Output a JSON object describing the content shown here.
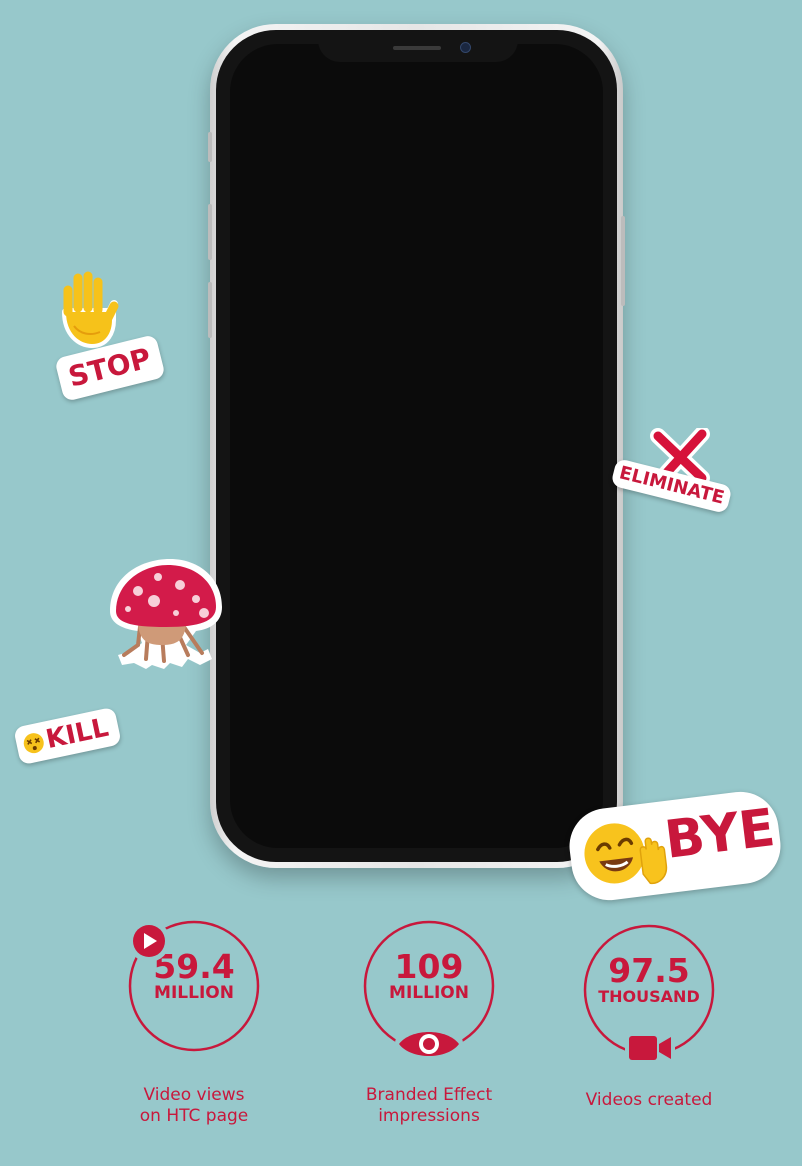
{
  "colors": {
    "background": "#97c8cb",
    "accent": "#c8183c",
    "sticker_bg": "#ffffff"
  },
  "stickers": {
    "stop": {
      "text": "STOP",
      "icon": "raised-hand-icon"
    },
    "eliminate": {
      "text": "ELIMINATE",
      "icon": "red-x-icon"
    },
    "mushroom": {
      "icon": "mushroom-creature-icon"
    },
    "kill": {
      "text": "KILL",
      "icon": "dizzy-face-icon"
    },
    "bye": {
      "text": "BYE",
      "icon": "waving-smiley-icon"
    }
  },
  "stats": [
    {
      "value": "59.4",
      "unit": "MILLION",
      "label_line1": "Video views",
      "label_line2": "on HTC page",
      "icon": "play-icon"
    },
    {
      "value": "109",
      "unit": "MILLION",
      "label_line1": "Branded Effect",
      "label_line2": "impressions",
      "icon": "eye-icon"
    },
    {
      "value": "97.5",
      "unit": "THOUSAND",
      "label_line1": "Videos created",
      "label_line2": "",
      "icon": "video-camera-icon"
    }
  ]
}
